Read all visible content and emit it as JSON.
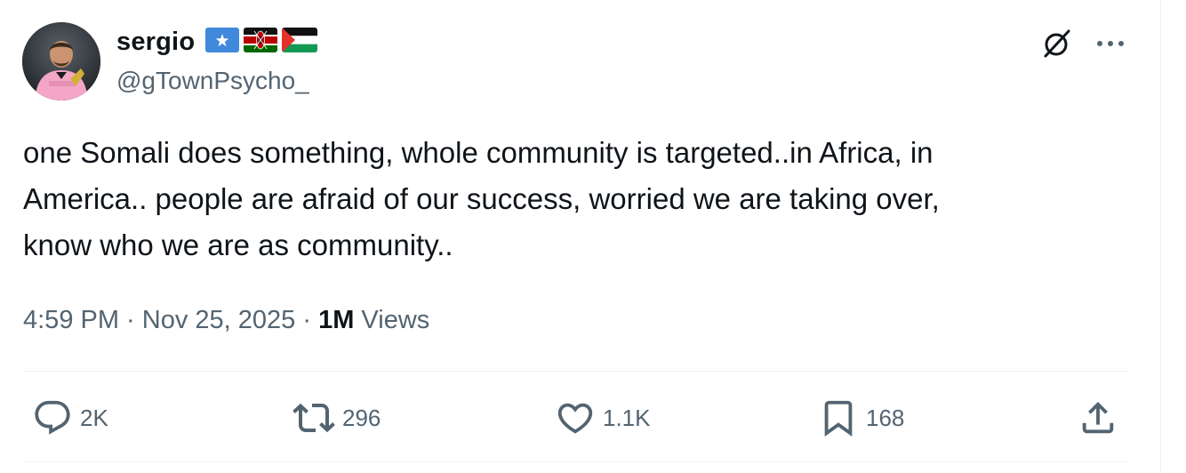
{
  "author": {
    "display_name": "sergio",
    "handle": "@gTownPsycho_",
    "flags": [
      "somalia-flag-icon",
      "kenya-flag-icon",
      "palestine-flag-icon"
    ]
  },
  "tweet": {
    "lines": [
      "one Somali does something, whole community is targeted..in Africa, in",
      "America.. people are afraid of our success, worried we are taking over,",
      "know who we are as community.."
    ]
  },
  "meta": {
    "time": "4:59 PM",
    "separator": " · ",
    "date": "Nov 25, 2025",
    "views_count": "1M",
    "views_label": " Views"
  },
  "actions": {
    "reply": {
      "icon": "reply-icon",
      "count": "2K"
    },
    "repost": {
      "icon": "repost-icon",
      "count": "296"
    },
    "like": {
      "icon": "heart-icon",
      "count": "1.1K"
    },
    "bookmark": {
      "icon": "bookmark-icon",
      "count": "168"
    },
    "share": {
      "icon": "share-icon"
    }
  },
  "colors": {
    "text": "#0f1419",
    "secondary": "#536471",
    "divider": "#eff3f4"
  }
}
